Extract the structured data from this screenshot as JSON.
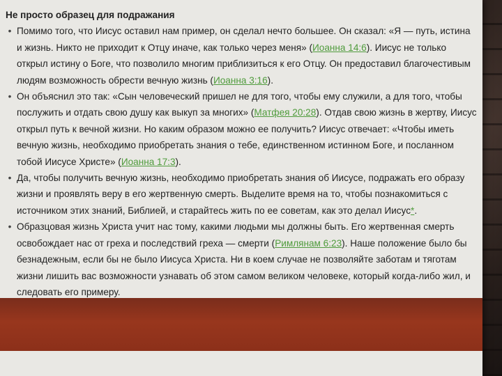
{
  "slide": {
    "title": "Не просто образец для подражания",
    "bullets": [
      {
        "parts": [
          {
            "t": "Помимо того, что Иисус оставил нам пример, он сделал нечто большее. Он сказал: «Я — путь, истина и жизнь. Никто не приходит к Отцу иначе, как только через меня» ("
          },
          {
            "t": "Иоанна 14:6",
            "link": true
          },
          {
            "t": "). Иисус не только открыл истину о Боге, что позволило многим приблизиться к его Отцу. Он предоставил благочестивым людям возможность обрести вечную жизнь ("
          },
          {
            "t": "Иоанна 3:16",
            "link": true
          },
          {
            "t": ")."
          }
        ]
      },
      {
        "parts": [
          {
            "t": "Он объяснил это так: «Сын человеческий пришел не для того, чтобы ему служили, а для того, чтобы послужить и отдать свою душу как выкуп за многих» ("
          },
          {
            "t": "Матфея 20:28",
            "link": true
          },
          {
            "t": "). Отдав свою жизнь в жертву, Иисус открыл путь к вечной жизни. Но каким образом можно ее получить? Иисус отвечает: «Чтобы иметь вечную жизнь, необходимо приобретать знания о тебе, единственном истинном Боге, и посланном тобой Иисусе Христе» ("
          },
          {
            "t": "Иоанна 17:3",
            "link": true
          },
          {
            "t": ")."
          }
        ]
      },
      {
        "parts": [
          {
            "t": "Да, чтобы получить вечную жизнь, необходимо приобретать знания об Иисусе, подражать его образу жизни и проявлять веру в его жертвенную смерть. Выделите время на то, чтобы познакомиться с источником этих знаний, Библией, и старайтесь жить по ее советам, как это делал Иисус"
          },
          {
            "t": "*",
            "link": true
          },
          {
            "t": "."
          }
        ]
      },
      {
        "parts": [
          {
            "t": "Образцовая жизнь Христа учит нас тому, какими людьми мы должны быть. Его жертвенная смерть освобождает нас от греха и последствий греха — смерти ("
          },
          {
            "t": "Римлянам 6:23",
            "link": true
          },
          {
            "t": "). Наше положение было бы безнадежным, если бы не было Иисуса Христа. Ни в коем случае не позволяйте заботам и тяготам жизни лишить вас возможности узнавать об этом самом великом человеке, который когда-либо жил, и следовать его примеру."
          }
        ]
      }
    ],
    "bullet_glyph": "•"
  },
  "colors": {
    "card": "#e9e8e4",
    "band": "#98361d",
    "link": "#4f9b3c",
    "text": "#222222"
  }
}
